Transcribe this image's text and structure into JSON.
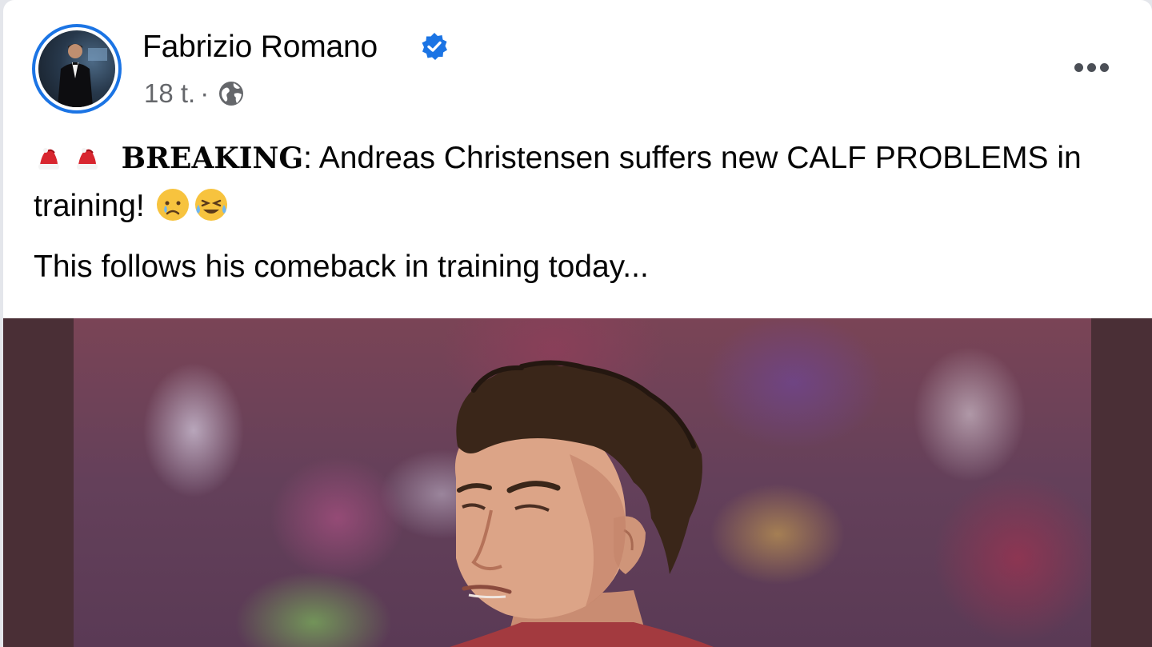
{
  "post": {
    "author": {
      "name": "Fabrizio Romano",
      "verified": true
    },
    "timestamp": "18 t.",
    "separator": "·",
    "audience_icon": "globe-icon",
    "more_icon": "more-options-icon",
    "text": {
      "breaking_label": "BREAKING",
      "line1_rest": ": Andreas Christensen suffers new CALF PROBLEMS in training!",
      "line2": "This follows his comeback in training today..."
    },
    "emojis": [
      "red-hat-emoji",
      "red-hat-emoji",
      "crying-face-emoji",
      "tears-of-joy-emoji"
    ]
  },
  "colors": {
    "verified_blue": "#1b74e4",
    "secondary_text": "#65676b",
    "primary_text": "#050505",
    "media_border": "#4a2f36"
  }
}
